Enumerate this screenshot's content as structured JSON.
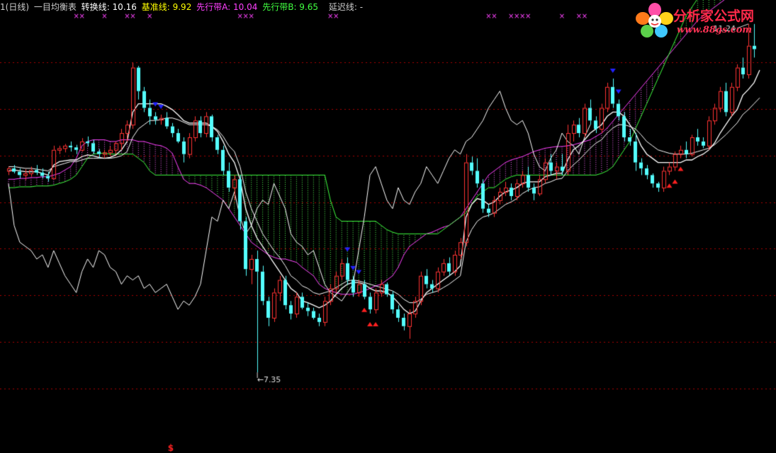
{
  "header": {
    "period": "1(日线)",
    "indicator": "一目均衡表",
    "conversion": {
      "label": "转换线",
      "value": "10.16",
      "color": "#ffffff"
    },
    "base": {
      "label": "基准线",
      "value": "9.92",
      "color": "#ffff00"
    },
    "spanA": {
      "label": "先行带A",
      "value": "10.04",
      "color": "#ff40ff"
    },
    "spanB": {
      "label": "先行带B",
      "value": "9.65",
      "color": "#40ff40"
    },
    "lagging": {
      "label": "延迟线",
      "value": "-"
    }
  },
  "logo": {
    "title": "分析家公式网",
    "url": "www.88gs.com"
  },
  "chart_data": {
    "type": "candlestick",
    "ylim": [
      6.6,
      11.6
    ],
    "high_label": "11.24",
    "low_label": "7.35",
    "dollar_mark": "$",
    "colors": {
      "up": "#ff3333",
      "down": "#55ffff",
      "conversion": "#ffffff",
      "base": "#ffffff",
      "spanA": "#ff40ff",
      "spanB": "#40ff40",
      "cloudA": "#ff66ff",
      "cloudB": "#55ff55",
      "lagging": "#ffffff",
      "markX": "#ff44ff",
      "buy": "#ff2020",
      "sell": "#2222ff",
      "grid": "#aa0000"
    },
    "candles": [
      [
        9.75,
        9.8,
        9.7,
        9.78
      ],
      [
        9.78,
        9.82,
        9.72,
        9.74
      ],
      [
        9.74,
        9.78,
        9.66,
        9.7
      ],
      [
        9.7,
        9.77,
        9.64,
        9.72
      ],
      [
        9.72,
        9.8,
        9.68,
        9.76
      ],
      [
        9.76,
        9.82,
        9.7,
        9.73
      ],
      [
        9.73,
        9.78,
        9.66,
        9.69
      ],
      [
        9.69,
        9.74,
        9.62,
        9.66
      ],
      [
        9.66,
        10.05,
        9.65,
        10.0
      ],
      [
        10.0,
        10.05,
        9.95,
        10.02
      ],
      [
        10.02,
        10.07,
        9.97,
        10.05
      ],
      [
        10.05,
        10.1,
        9.98,
        10.03
      ],
      [
        10.03,
        10.06,
        9.95,
        10.0
      ],
      [
        10.0,
        10.14,
        9.98,
        10.1
      ],
      [
        10.1,
        10.16,
        10.04,
        10.08
      ],
      [
        10.08,
        10.12,
        9.95,
        9.98
      ],
      [
        9.98,
        10.01,
        9.9,
        9.95
      ],
      [
        9.95,
        10.0,
        9.9,
        9.97
      ],
      [
        9.97,
        10.04,
        9.93,
        10.0
      ],
      [
        10.0,
        10.1,
        9.95,
        10.08
      ],
      [
        10.08,
        10.25,
        10.0,
        10.2
      ],
      [
        10.2,
        10.35,
        10.1,
        10.3
      ],
      [
        10.3,
        11.04,
        10.25,
        10.98
      ],
      [
        10.98,
        11.0,
        10.6,
        10.7
      ],
      [
        10.7,
        10.75,
        10.45,
        10.5
      ],
      [
        10.5,
        10.6,
        10.3,
        10.4
      ],
      [
        10.4,
        10.45,
        10.3,
        10.36
      ],
      [
        10.36,
        10.42,
        10.3,
        10.38
      ],
      [
        10.38,
        10.45,
        10.25,
        10.28
      ],
      [
        10.28,
        10.32,
        10.15,
        10.2
      ],
      [
        10.2,
        10.25,
        10.08,
        10.1
      ],
      [
        10.1,
        10.15,
        9.85,
        9.95
      ],
      [
        9.95,
        10.2,
        9.9,
        10.15
      ],
      [
        10.15,
        10.4,
        10.1,
        10.35
      ],
      [
        10.35,
        10.4,
        10.15,
        10.2
      ],
      [
        10.2,
        10.45,
        10.15,
        10.4
      ],
      [
        10.4,
        10.42,
        10.1,
        10.15
      ],
      [
        10.15,
        10.18,
        9.95,
        10.0
      ],
      [
        10.0,
        10.05,
        9.7,
        9.75
      ],
      [
        9.75,
        9.85,
        9.5,
        9.55
      ],
      [
        9.55,
        9.7,
        9.4,
        9.65
      ],
      [
        9.65,
        9.7,
        9.05,
        9.15
      ],
      [
        9.15,
        9.2,
        8.5,
        8.58
      ],
      [
        8.58,
        8.75,
        8.4,
        8.7
      ],
      [
        8.7,
        8.8,
        7.35,
        8.55
      ],
      [
        8.55,
        8.62,
        8.15,
        8.2
      ],
      [
        8.2,
        8.25,
        7.9,
        8.0
      ],
      [
        8.0,
        8.35,
        7.95,
        8.3
      ],
      [
        8.3,
        8.5,
        8.2,
        8.45
      ],
      [
        8.45,
        8.5,
        8.1,
        8.15
      ],
      [
        8.15,
        8.2,
        7.98,
        8.05
      ],
      [
        8.05,
        8.3,
        8.0,
        8.25
      ],
      [
        8.25,
        8.3,
        8.1,
        8.12
      ],
      [
        8.12,
        8.18,
        8.02,
        8.08
      ],
      [
        8.08,
        8.12,
        7.98,
        8.0
      ],
      [
        8.0,
        8.05,
        7.9,
        7.95
      ],
      [
        7.95,
        8.25,
        7.9,
        8.2
      ],
      [
        8.2,
        8.4,
        8.15,
        8.35
      ],
      [
        8.35,
        8.55,
        8.3,
        8.5
      ],
      [
        8.5,
        8.7,
        8.45,
        8.65
      ],
      [
        8.65,
        8.72,
        8.4,
        8.45
      ],
      [
        8.45,
        8.5,
        8.25,
        8.3
      ],
      [
        8.3,
        8.45,
        8.25,
        8.4
      ],
      [
        8.4,
        8.45,
        8.22,
        8.25
      ],
      [
        8.25,
        8.3,
        8.05,
        8.1
      ],
      [
        8.1,
        8.35,
        8.05,
        8.3
      ],
      [
        8.3,
        8.45,
        8.25,
        8.4
      ],
      [
        8.4,
        8.42,
        8.25,
        8.28
      ],
      [
        8.28,
        8.32,
        8.05,
        8.1
      ],
      [
        8.1,
        8.15,
        7.95,
        8.0
      ],
      [
        8.0,
        8.05,
        7.85,
        7.9
      ],
      [
        7.9,
        8.1,
        7.75,
        8.05
      ],
      [
        8.05,
        8.25,
        8.0,
        8.2
      ],
      [
        8.2,
        8.55,
        8.15,
        8.5
      ],
      [
        8.5,
        8.58,
        8.35,
        8.4
      ],
      [
        8.4,
        8.45,
        8.3,
        8.35
      ],
      [
        8.35,
        8.6,
        8.3,
        8.55
      ],
      [
        8.55,
        8.7,
        8.5,
        8.65
      ],
      [
        8.65,
        8.72,
        8.5,
        8.55
      ],
      [
        8.55,
        8.8,
        8.5,
        8.75
      ],
      [
        8.75,
        8.95,
        8.7,
        8.9
      ],
      [
        8.9,
        9.95,
        8.85,
        9.85
      ],
      [
        9.85,
        9.92,
        9.7,
        9.75
      ],
      [
        9.75,
        9.9,
        9.55,
        9.6
      ],
      [
        9.6,
        9.65,
        9.25,
        9.3
      ],
      [
        9.3,
        9.35,
        9.2,
        9.25
      ],
      [
        9.25,
        9.45,
        9.2,
        9.4
      ],
      [
        9.4,
        9.55,
        9.35,
        9.5
      ],
      [
        9.5,
        9.62,
        9.45,
        9.55
      ],
      [
        9.55,
        9.6,
        9.4,
        9.45
      ],
      [
        9.45,
        9.65,
        9.4,
        9.6
      ],
      [
        9.6,
        9.75,
        9.55,
        9.7
      ],
      [
        9.7,
        9.8,
        9.5,
        9.55
      ],
      [
        9.55,
        9.6,
        9.4,
        9.48
      ],
      [
        9.48,
        9.7,
        9.45,
        9.65
      ],
      [
        9.65,
        9.9,
        9.6,
        9.85
      ],
      [
        9.85,
        9.95,
        9.7,
        9.75
      ],
      [
        9.75,
        9.85,
        9.65,
        9.8
      ],
      [
        9.8,
        9.95,
        9.7,
        9.75
      ],
      [
        9.75,
        10.3,
        9.7,
        10.2
      ],
      [
        10.2,
        10.35,
        10.1,
        10.3
      ],
      [
        10.3,
        10.38,
        10.15,
        10.2
      ],
      [
        10.2,
        10.55,
        10.15,
        10.5
      ],
      [
        10.5,
        10.6,
        10.3,
        10.35
      ],
      [
        10.35,
        10.4,
        10.2,
        10.25
      ],
      [
        10.25,
        10.55,
        10.2,
        10.5
      ],
      [
        10.5,
        10.8,
        10.45,
        10.75
      ],
      [
        10.75,
        10.85,
        10.5,
        10.55
      ],
      [
        10.55,
        10.6,
        10.35,
        10.4
      ],
      [
        10.4,
        10.45,
        10.1,
        10.15
      ],
      [
        10.15,
        10.25,
        10.05,
        10.1
      ],
      [
        10.1,
        10.2,
        9.75,
        9.85
      ],
      [
        9.85,
        9.9,
        9.7,
        9.78
      ],
      [
        9.78,
        9.82,
        9.65,
        9.7
      ],
      [
        9.7,
        9.72,
        9.55,
        9.6
      ],
      [
        9.6,
        9.62,
        9.5,
        9.55
      ],
      [
        9.55,
        9.8,
        9.5,
        9.75
      ],
      [
        9.75,
        9.85,
        9.7,
        9.8
      ],
      [
        9.8,
        9.98,
        9.75,
        9.95
      ],
      [
        9.95,
        10.05,
        9.9,
        10.0
      ],
      [
        10.0,
        10.1,
        9.9,
        9.95
      ],
      [
        9.95,
        10.18,
        9.92,
        10.15
      ],
      [
        10.15,
        10.25,
        10.05,
        10.1
      ],
      [
        10.1,
        10.15,
        10.02,
        10.05
      ],
      [
        10.05,
        10.4,
        10.0,
        10.35
      ],
      [
        10.35,
        10.55,
        10.3,
        10.5
      ],
      [
        10.5,
        10.75,
        10.45,
        10.7
      ],
      [
        10.7,
        10.8,
        10.4,
        10.45
      ],
      [
        10.45,
        10.8,
        10.4,
        10.75
      ],
      [
        10.75,
        11.02,
        10.7,
        10.98
      ],
      [
        10.98,
        11.1,
        10.85,
        10.9
      ],
      [
        10.9,
        11.5,
        10.85,
        11.24
      ],
      [
        11.24,
        11.5,
        11.1,
        11.2
      ]
    ],
    "conversion": [
      9.75,
      9.76,
      9.75,
      9.74,
      9.74,
      9.74,
      9.72,
      9.7,
      9.82,
      9.86,
      9.87,
      9.88,
      9.88,
      9.92,
      9.94,
      9.93,
      9.91,
      9.9,
      9.91,
      9.94,
      10.0,
      10.1,
      10.45,
      10.55,
      10.55,
      10.55,
      10.55,
      10.55,
      10.52,
      10.48,
      10.42,
      10.35,
      10.32,
      10.32,
      10.32,
      10.32,
      10.28,
      10.22,
      10.1,
      9.95,
      9.85,
      9.65,
      9.3,
      9.1,
      8.95,
      8.85,
      8.75,
      8.65,
      8.55,
      8.45,
      8.35,
      8.3,
      8.2,
      8.18,
      8.15,
      8.12,
      8.15,
      8.2,
      8.28,
      8.35,
      8.4,
      8.42,
      8.42,
      8.4,
      8.35,
      8.32,
      8.32,
      8.3,
      8.25,
      8.18,
      8.1,
      8.05,
      8.08,
      8.2,
      8.3,
      8.35,
      8.4,
      8.45,
      8.5,
      8.55,
      8.62,
      9.2,
      9.35,
      9.42,
      9.4,
      9.35,
      9.38,
      9.45,
      9.5,
      9.52,
      9.55,
      9.6,
      9.62,
      9.62,
      9.62,
      9.68,
      9.7,
      9.72,
      9.72,
      9.88,
      10.0,
      10.05,
      10.12,
      10.2,
      10.25,
      10.3,
      10.4,
      10.45,
      10.45,
      10.4,
      10.3,
      10.2,
      10.05,
      9.95,
      9.9,
      9.85,
      9.85,
      9.85,
      9.85,
      9.85,
      9.88,
      9.88,
      9.92,
      9.95,
      10.0,
      10.08,
      10.2,
      10.3,
      10.4,
      10.48,
      10.65,
      10.72,
      10.8,
      10.95
    ],
    "base": [
      9.8,
      9.8,
      9.79,
      9.78,
      9.78,
      9.77,
      9.76,
      9.75,
      9.8,
      9.82,
      9.84,
      9.86,
      9.86,
      9.88,
      9.9,
      9.9,
      9.9,
      9.9,
      9.9,
      9.91,
      9.93,
      9.98,
      10.15,
      10.25,
      10.3,
      10.35,
      10.35,
      10.36,
      10.38,
      10.38,
      10.36,
      10.33,
      10.3,
      10.3,
      10.3,
      10.3,
      10.28,
      10.24,
      10.16,
      10.05,
      9.98,
      9.8,
      9.5,
      9.3,
      9.15,
      9.0,
      8.9,
      8.8,
      8.72,
      8.62,
      8.5,
      8.45,
      8.38,
      8.35,
      8.3,
      8.28,
      8.3,
      8.32,
      8.36,
      8.4,
      8.44,
      8.45,
      8.44,
      8.42,
      8.4,
      8.38,
      8.36,
      8.34,
      8.32,
      8.28,
      8.22,
      8.18,
      8.18,
      8.22,
      8.28,
      8.3,
      8.32,
      8.36,
      8.4,
      8.45,
      8.5,
      8.9,
      9.05,
      9.15,
      9.2,
      9.22,
      9.25,
      9.3,
      9.35,
      9.38,
      9.42,
      9.48,
      9.52,
      9.55,
      9.56,
      9.6,
      9.62,
      9.65,
      9.66,
      9.75,
      9.82,
      9.88,
      9.95,
      10.02,
      10.08,
      10.12,
      10.2,
      10.26,
      10.3,
      10.3,
      10.28,
      10.25,
      10.18,
      10.1,
      10.05,
      10.0,
      9.98,
      9.96,
      9.95,
      9.95,
      9.95,
      9.96,
      9.98,
      10.0,
      10.02,
      10.06,
      10.12,
      10.18,
      10.25,
      10.32,
      10.42,
      10.48,
      10.55,
      10.62
    ],
    "spanA": [
      9.65,
      9.65,
      9.66,
      9.66,
      9.67,
      9.67,
      9.68,
      9.68,
      9.7,
      9.72,
      9.76,
      9.8,
      9.9,
      10.05,
      10.1,
      10.12,
      10.12,
      10.12,
      10.1,
      10.1,
      10.12,
      10.12,
      10.12,
      10.1,
      10.1,
      10.08,
      10.06,
      10.05,
      10.02,
      9.96,
      9.8,
      9.65,
      9.6,
      9.6,
      9.58,
      9.55,
      9.5,
      9.45,
      9.4,
      9.3,
      9.2,
      9.1,
      9.0,
      8.9,
      8.85,
      8.8,
      8.75,
      8.72,
      8.7,
      8.7,
      8.68,
      8.66,
      8.6,
      8.55,
      8.5,
      8.4,
      8.35,
      8.32,
      8.3,
      8.28,
      8.28,
      8.28,
      8.3,
      8.32,
      8.35,
      8.38,
      8.4,
      8.45,
      8.5,
      8.6,
      8.75,
      8.85,
      8.9,
      8.95,
      9.0,
      9.02,
      9.05,
      9.08,
      9.1,
      9.15,
      9.2,
      9.3,
      9.4,
      9.5,
      9.6,
      9.7,
      9.75,
      9.8,
      9.85,
      9.88,
      9.9,
      9.92,
      9.95,
      9.98,
      10.0,
      10.02,
      10.03,
      10.04,
      10.04,
      10.05,
      10.06,
      10.08,
      10.1,
      10.12,
      10.16,
      10.2,
      10.26,
      10.34,
      10.42,
      10.5,
      10.58,
      10.66,
      10.74,
      10.82,
      10.9,
      10.98,
      11.06,
      11.14,
      11.22,
      11.3,
      11.38,
      11.46,
      11.54,
      11.6,
      11.65,
      11.7,
      11.75,
      11.8,
      11.85,
      11.9,
      11.92,
      11.94,
      11.96,
      11.98
    ],
    "spanB": [
      9.55,
      9.55,
      9.56,
      9.56,
      9.56,
      9.57,
      9.57,
      9.57,
      9.58,
      9.6,
      9.62,
      9.65,
      9.7,
      9.8,
      9.9,
      9.95,
      9.96,
      9.96,
      9.95,
      9.95,
      9.95,
      9.95,
      9.95,
      9.9,
      9.85,
      9.75,
      9.7,
      9.7,
      9.7,
      9.7,
      9.7,
      9.7,
      9.7,
      9.7,
      9.7,
      9.7,
      9.7,
      9.7,
      9.7,
      9.7,
      9.7,
      9.7,
      9.7,
      9.7,
      9.7,
      9.7,
      9.7,
      9.7,
      9.7,
      9.7,
      9.7,
      9.7,
      9.7,
      9.7,
      9.7,
      9.7,
      9.7,
      9.4,
      9.2,
      9.15,
      9.15,
      9.15,
      9.15,
      9.15,
      9.15,
      9.15,
      9.1,
      9.05,
      9.02,
      9.0,
      9.0,
      9.0,
      9.0,
      9.0,
      9.0,
      9.0,
      9.0,
      9.05,
      9.1,
      9.15,
      9.2,
      9.25,
      9.35,
      9.45,
      9.5,
      9.55,
      9.55,
      9.6,
      9.65,
      9.68,
      9.7,
      9.7,
      9.7,
      9.7,
      9.7,
      9.7,
      9.7,
      9.7,
      9.7,
      9.7,
      9.7,
      9.7,
      9.7,
      9.7,
      9.7,
      9.72,
      9.75,
      9.8,
      9.9,
      10.0,
      10.1,
      10.25,
      10.4,
      10.55,
      10.7,
      10.85,
      11.0,
      11.15,
      11.3,
      11.45,
      11.6,
      11.7,
      11.8,
      11.85,
      11.9,
      11.95,
      12.0,
      12.05,
      12.1,
      12.15,
      12.18,
      12.2,
      12.22,
      12.25
    ],
    "lagging": [
      9.6,
      9.1,
      8.9,
      8.85,
      8.8,
      8.7,
      8.75,
      8.6,
      8.8,
      8.65,
      8.5,
      8.4,
      8.3,
      8.55,
      8.7,
      8.6,
      8.8,
      8.75,
      8.6,
      8.55,
      8.4,
      8.5,
      8.45,
      8.5,
      8.35,
      8.4,
      8.3,
      8.35,
      8.4,
      8.25,
      8.1,
      8.2,
      8.15,
      8.25,
      8.4,
      8.8,
      9.2,
      9.15,
      9.4,
      9.3,
      9.5,
      9.2,
      9.0,
      9.1,
      9.3,
      9.4,
      9.35,
      9.6,
      9.45,
      9.3,
      9.0,
      8.9,
      8.85,
      8.75,
      8.8,
      8.6,
      8.4,
      8.3,
      8.25,
      8.2,
      8.3,
      8.4,
      8.8,
      9.2,
      9.7,
      9.8,
      9.6,
      9.4,
      9.3,
      9.55,
      9.4,
      9.35,
      9.5,
      9.6,
      9.8,
      9.7,
      9.6,
      9.75,
      9.9,
      10.0,
      9.95,
      10.1,
      10.15,
      10.25,
      10.35,
      10.5,
      10.6,
      10.7,
      10.5,
      10.35,
      10.3,
      10.35,
      10.2,
      9.95,
      9.8,
      9.75,
      9.9,
      10.0,
      10.2,
      10.1,
      10.05,
      9.95,
      10.15,
      10.3,
      10.4,
      10.5,
      10.55,
      10.7,
      10.9,
      11.1,
      11.3,
      11.5,
      11.7,
      11.9,
      12.1,
      12.3,
      12.5,
      12.7,
      12.9,
      13.1,
      13.3,
      13.5,
      13.7,
      13.9,
      14.1,
      14.3,
      14.5
    ],
    "marks_x": [
      12,
      13,
      17,
      21,
      22,
      25,
      41,
      42,
      43,
      57,
      58,
      85,
      86,
      89,
      90,
      91,
      92,
      98,
      101,
      102
    ],
    "buy_signals": [
      63,
      64,
      65,
      117,
      118,
      119
    ],
    "sell_signals": [
      26,
      27,
      60,
      61,
      62,
      107,
      108
    ]
  }
}
